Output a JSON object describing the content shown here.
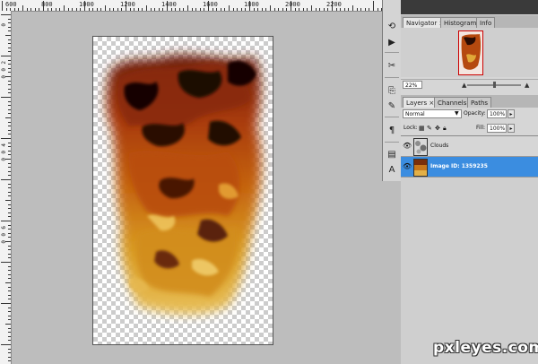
{
  "ruler": {
    "top_labels": [
      "600",
      "800",
      "1000",
      "1200",
      "1400",
      "1600",
      "1800",
      "2000",
      "2200"
    ],
    "left_labels": [
      "0",
      "2",
      "0",
      "0",
      "4",
      "0",
      "0",
      "6",
      "0",
      "0"
    ]
  },
  "toolstrip": {
    "icons": [
      "history-icon",
      "actions-icon",
      "tools-icon",
      "clone-source-icon",
      "brush-icon",
      "paragraph-icon",
      "layer-comps-icon",
      "character-icon"
    ]
  },
  "navigator": {
    "tabs": [
      "Navigator ×",
      "Histogram",
      "Info"
    ],
    "zoom": "22%"
  },
  "layers_panel": {
    "tabs": [
      "Layers ×",
      "Channels",
      "Paths"
    ],
    "blend_mode": "Normal",
    "opacity_label": "Opacity:",
    "opacity_value": "100%",
    "lock_label": "Lock:",
    "fill_label": "Fill:",
    "fill_value": "100%",
    "layers": [
      {
        "name": "Clouds",
        "selected": false
      },
      {
        "name": "Image ID: 1359235",
        "selected": true
      }
    ]
  },
  "watermark": "pxleyes.com",
  "colors": {
    "workspace": "#bdbdbd",
    "selection": "#3b8de0"
  }
}
